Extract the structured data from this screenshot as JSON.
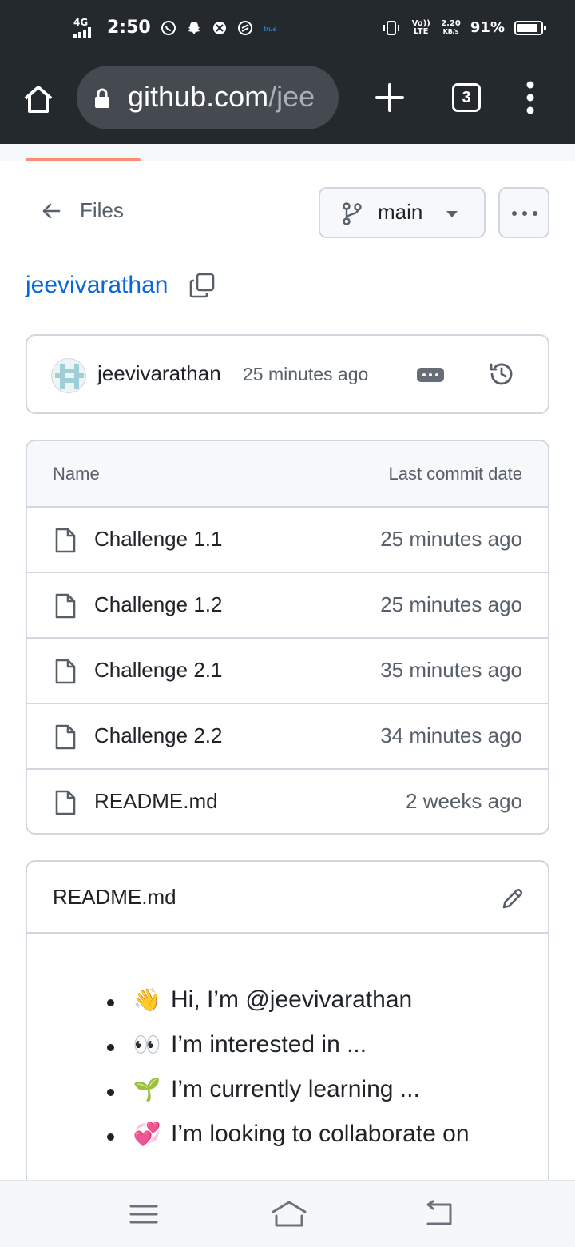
{
  "status_bar": {
    "network": "4G",
    "time": "2:50",
    "volte": "Vo)) LTE",
    "speed_value": "2.20",
    "speed_unit": "KB/s",
    "battery": "91%",
    "battery_level": 0.91,
    "icons": [
      "whatsapp-icon",
      "snapchat-icon",
      "app-icon",
      "app-icon-2",
      "true-icon",
      "vibrate-icon"
    ]
  },
  "browser": {
    "url_host": "github.com",
    "url_path": "/jee",
    "tab_count": "3",
    "icons": [
      "home-icon",
      "lock-icon",
      "plus-icon",
      "menu-icon"
    ]
  },
  "repo_nav": {
    "back_label": "Files",
    "branch": "main",
    "owner": "jeevivarathan"
  },
  "latest_commit": {
    "author": "jeevivarathan",
    "time": "25 minutes ago"
  },
  "files": {
    "columns": [
      "Name",
      "Last commit date"
    ],
    "rows": [
      {
        "name": "Challenge 1.1",
        "date": "25 minutes ago"
      },
      {
        "name": "Challenge 1.2",
        "date": "25 minutes ago"
      },
      {
        "name": "Challenge 2.1",
        "date": "35 minutes ago"
      },
      {
        "name": "Challenge 2.2",
        "date": "34 minutes ago"
      },
      {
        "name": "README.md",
        "date": "2 weeks ago"
      }
    ]
  },
  "readme": {
    "title": "README.md",
    "items": [
      {
        "emoji": "👋",
        "text": "Hi, I’m @jeevivarathan"
      },
      {
        "emoji": "👀",
        "text": "I’m interested in ..."
      },
      {
        "emoji": "🌱",
        "text": "I’m currently learning ..."
      },
      {
        "emoji": "💞️",
        "text": "I’m looking to collaborate on"
      }
    ]
  },
  "colors": {
    "chrome_bg": "#24292e",
    "link": "#0969da",
    "border": "#d0d7de",
    "muted": "#57606a",
    "progress": "#fd8c73"
  }
}
